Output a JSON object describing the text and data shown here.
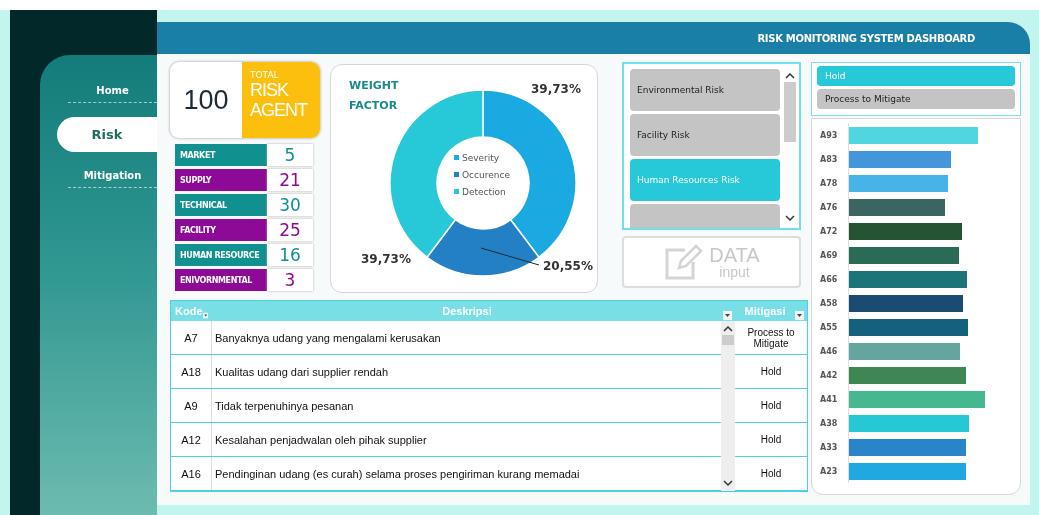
{
  "header": {
    "title": "RISK MONITORING SYSTEM DASHBOARD"
  },
  "nav": [
    {
      "label": "Home",
      "selected": false
    },
    {
      "label": "Risk",
      "selected": true
    },
    {
      "label": "Mitigation",
      "selected": false
    }
  ],
  "total": {
    "value": "100",
    "caption": "TOTAL",
    "title_1": "RISK",
    "title_2": "AGENT"
  },
  "categories": [
    {
      "label": "MARKET",
      "count": "5",
      "color": "#10918f"
    },
    {
      "label": "SUPPLY",
      "count": "21",
      "color": "#8c0a96"
    },
    {
      "label": "TECHNICAL",
      "count": "30",
      "color": "#10918f"
    },
    {
      "label": "FACILITY",
      "count": "25",
      "color": "#8c0a96"
    },
    {
      "label": "HUMAN RESOURCE",
      "count": "16",
      "color": "#10918f"
    },
    {
      "label": "ENIVORNMENTAL",
      "count": "3",
      "color": "#8c0a96"
    }
  ],
  "weight_factor": {
    "chart_data": {
      "type": "donut",
      "title": "WEIGHT FACTOR",
      "categories": [
        "Severity",
        "Occurence",
        "Detection"
      ],
      "values": [
        39.73,
        20.55,
        39.73
      ],
      "legend": true,
      "colors": [
        "#1ba9e1",
        "#2380c4",
        "#27c8d8"
      ],
      "value_labels": [
        "39,73%",
        "20,55%",
        "39,73%"
      ]
    }
  },
  "risk_slicer": [
    {
      "label": "Environmental Risk",
      "selected": false
    },
    {
      "label": "Facility Risk",
      "selected": false
    },
    {
      "label": "Human Resources Risk",
      "selected": true
    }
  ],
  "data_input": {
    "line_1": "DATA",
    "line_2": "input"
  },
  "mitigation_slicer": [
    {
      "label": "Hold",
      "selected": true
    },
    {
      "label": "Process to Mitigate",
      "selected": false
    }
  ],
  "risk_bars": [
    {
      "code": "A93",
      "color": "#4fd6e0"
    },
    {
      "code": "A83",
      "color": "#4396d9"
    },
    {
      "code": "A78",
      "color": "#47b4e8"
    },
    {
      "code": "A76",
      "color": "#3a6561"
    },
    {
      "code": "A72",
      "color": "#245433"
    },
    {
      "code": "A69",
      "color": "#2a6b58"
    },
    {
      "code": "A66",
      "color": "#1b7478"
    },
    {
      "code": "A58",
      "color": "#1a4b73"
    },
    {
      "code": "A55",
      "color": "#13607f"
    },
    {
      "code": "A46",
      "color": "#64a69f"
    },
    {
      "code": "A42",
      "color": "#3f8752"
    },
    {
      "code": "A41",
      "color": "#46b890"
    },
    {
      "code": "A38",
      "color": "#27c8d6"
    },
    {
      "code": "A33",
      "color": "#2785c8"
    },
    {
      "code": "A23",
      "color": "#20a8e0"
    }
  ],
  "table": {
    "columns": [
      "Kode",
      "Deskripsi",
      "Mitigasi"
    ],
    "rows": [
      {
        "kode": "A7",
        "deskripsi": "Banyaknya udang yang mengalami kerusakan",
        "mitigasi": "Process to Mitigate"
      },
      {
        "kode": "A18",
        "deskripsi": "Kualitas udang dari supplier rendah",
        "mitigasi": "Hold"
      },
      {
        "kode": "A9",
        "deskripsi": "Tidak terpenuhinya pesanan",
        "mitigasi": "Hold"
      },
      {
        "kode": "A12",
        "deskripsi": "Kesalahan penjadwalan oleh pihak supplier",
        "mitigasi": "Hold"
      },
      {
        "kode": "A16",
        "deskripsi": "Pendinginan udang (es curah) selama proses pengiriman kurang memadai",
        "mitigasi": "Hold"
      }
    ]
  }
}
